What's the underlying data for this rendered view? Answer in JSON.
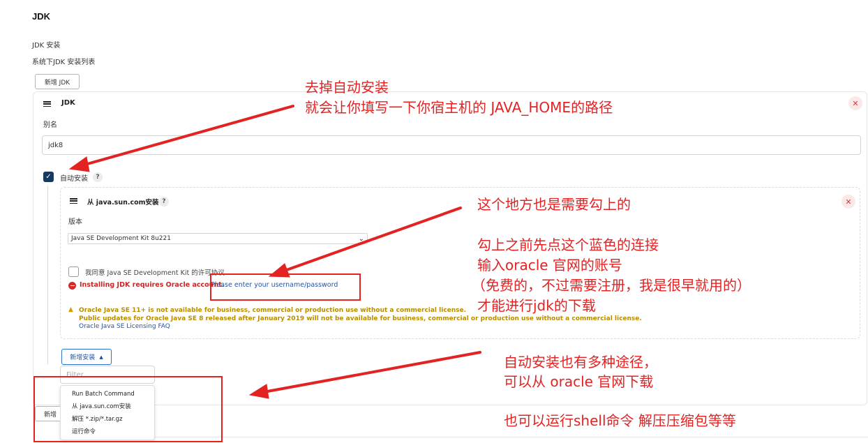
{
  "section": {
    "title": "JDK"
  },
  "jdk_install": {
    "label": "JDK 安装",
    "description": "系统下JDK 安装列表",
    "add_button": "新增 JDK"
  },
  "jdk_item": {
    "title": "JDK",
    "alias_label": "别名",
    "alias_value": "jdk8",
    "auto_install_label": "自动安装",
    "help": "?"
  },
  "installer": {
    "title": "从 java.sun.com安装",
    "version_label": "版本",
    "version_value": "Java SE Development Kit 8u221",
    "agree_label": "我同意 Java SE Development Kit 的许可协议",
    "error_text": "Installing JDK requires Oracle account.",
    "error_link": "Please enter your username/password",
    "warning_line1": "Oracle Java SE 11+ is not available for business, commercial or production use without a commercial license.",
    "warning_line2": "Public updates for Oracle Java SE 8 released after January 2019 will not be available for business, commercial or production use without a commercial license.",
    "faq_link": "Oracle Java SE Licensing FAQ"
  },
  "add_installer": {
    "button": "新增安装",
    "filter_placeholder": "Filter",
    "menu": [
      "Run Batch Command",
      "从 java.sun.com安装",
      "解压 *.zip/*.tar.gz",
      "运行命令"
    ]
  },
  "bottom_button_fragment": "新增",
  "annotations": {
    "a1_line1": "去掉自动安装",
    "a1_line2": "就会让你填写一下你宿主机的 JAVA_HOME的路径",
    "a2_line1": "这个地方也是需要勾上的",
    "a2_line2": "勾上之前先点这个蓝色的连接",
    "a2_line3": "输入oracle 官网的账号",
    "a2_line4": "（免费的，不过需要注册，我是很早就用的）",
    "a2_line5": "才能进行jdk的下载",
    "a3_line1": "自动安装也有多种途径，",
    "a3_line2": "可以从 oracle 官网下载",
    "a3_line3": "也可以运行shell命令 解压压缩包等等"
  },
  "colors": {
    "annotation": "#e32222",
    "checkbox": "#173a5e",
    "link": "#2754a3",
    "warning": "#b88d00",
    "error": "#d12b2b"
  }
}
